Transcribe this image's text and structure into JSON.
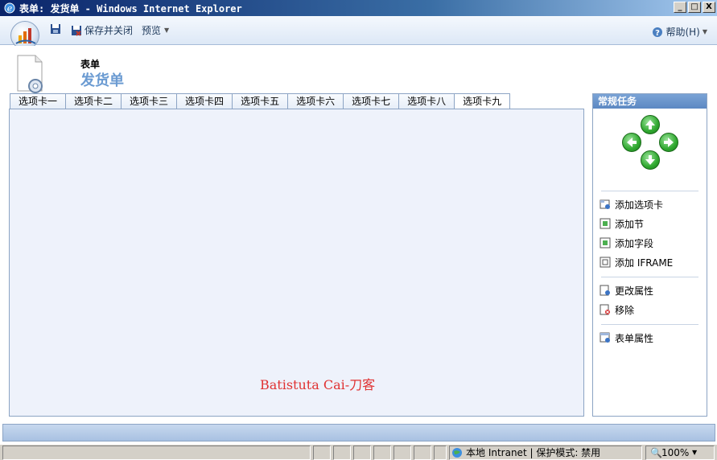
{
  "window": {
    "title": "表单: 发货单 - Windows Internet Explorer",
    "controls": {
      "minimize": "_",
      "maximize": "□",
      "close": "X"
    }
  },
  "toolbar": {
    "save_close_label": "保存并关闭",
    "preview_label": "预览",
    "help_label": "帮助(H)"
  },
  "header": {
    "form_kind": "表单",
    "form_name": "发货单"
  },
  "tabs": [
    {
      "label": "选项卡一"
    },
    {
      "label": "选项卡二"
    },
    {
      "label": "选项卡三"
    },
    {
      "label": "选项卡四"
    },
    {
      "label": "选项卡五"
    },
    {
      "label": "选项卡六"
    },
    {
      "label": "选项卡七"
    },
    {
      "label": "选项卡八"
    },
    {
      "label": "选项卡九",
      "active": true
    }
  ],
  "watermark": "Batistuta Cai-刀客",
  "task_pane": {
    "title": "常规任务",
    "groups": [
      [
        {
          "label": "添加选项卡",
          "icon": "add-tab-icon"
        },
        {
          "label": "添加节",
          "icon": "add-section-icon"
        },
        {
          "label": "添加字段",
          "icon": "add-field-icon"
        },
        {
          "label": "添加 IFRAME",
          "icon": "add-iframe-icon"
        }
      ],
      [
        {
          "label": "更改属性",
          "icon": "change-properties-icon"
        },
        {
          "label": "移除",
          "icon": "remove-icon"
        }
      ],
      [
        {
          "label": "表单属性",
          "icon": "form-properties-icon"
        }
      ]
    ]
  },
  "statusbar": {
    "zone_label": "本地 Intranet | 保护模式: 禁用",
    "zoom_label": "100%"
  },
  "colors": {
    "title_gradient_start": "#0a246a",
    "accent": "#6b9bd2",
    "panel_bg": "#eef2fb",
    "watermark": "#e03232",
    "arrow_green": "#2fa82f"
  }
}
